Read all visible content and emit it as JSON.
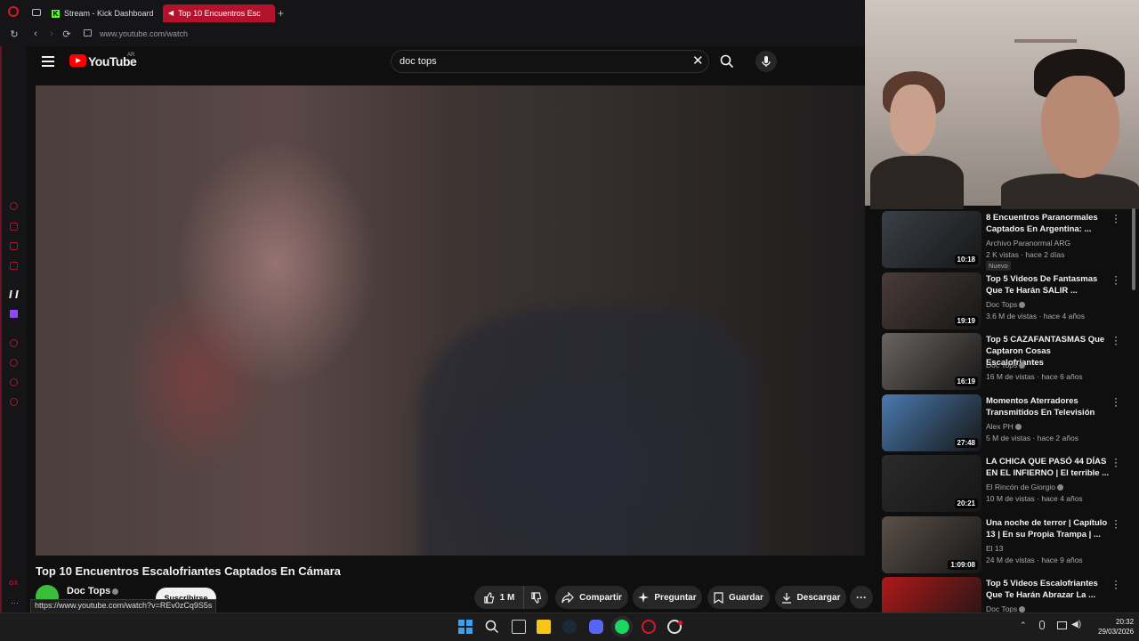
{
  "browser": {
    "tabs": [
      {
        "label": "Stream - Kick Dashboard",
        "active": false
      },
      {
        "label": "Top 10 Encuentros Esc",
        "active": true
      }
    ],
    "url": "www.youtube.com/watch",
    "status_url": "https://www.youtube.com/watch?v=REv0zCq9S5s"
  },
  "youtube": {
    "logo_text": "YouTube",
    "country_code": "AR",
    "search": {
      "value": "doc tops"
    },
    "video": {
      "title": "Top 10 Encuentros Escalofriantes Captados En Cámara",
      "channel": "Doc Tops",
      "subscribe_label": "Suscribirse",
      "like_count": "1 M",
      "share_label": "Compartir",
      "ask_label": "Preguntar",
      "save_label": "Guardar",
      "download_label": "Descargar"
    },
    "recommendations": [
      {
        "title": "8 Encuentros Paranormales Captados En Argentina: ...",
        "channel": "Archivo Paranormal ARG",
        "meta": "2 K vistas · hace 2 días",
        "duration": "10:18",
        "badge": "Nuevo",
        "verified": false,
        "thumb": "#3a4048"
      },
      {
        "title": "Top 5 Videos De Fantasmas Que Te Harán SALIR ...",
        "channel": "Doc Tops",
        "meta": "3.6 M de vistas · hace 4 años",
        "duration": "19:19",
        "badge": "",
        "verified": true,
        "thumb": "#4a3c38"
      },
      {
        "title": "Top 5 CAZAFANTASMAS Que Captaron Cosas Escalofriantes",
        "channel": "Doc Tops",
        "meta": "16 M de vistas · hace 6 años",
        "duration": "16:19",
        "badge": "",
        "verified": true,
        "thumb": "#6a6460"
      },
      {
        "title": "Momentos Aterradores Transmitidos En Televisión",
        "channel": "Alex PH",
        "meta": "5 M de vistas · hace 2 años",
        "duration": "27:48",
        "badge": "",
        "verified": true,
        "thumb": "#4a7ab0"
      },
      {
        "title": "LA CHICA QUE PASÓ 44 DÍAS EN EL INFIERNO | El terrible ...",
        "channel": "El Rincón de Giorgio",
        "meta": "10 M de vistas · hace 4 años",
        "duration": "20:21",
        "badge": "",
        "verified": true,
        "thumb": "#2a2a2a"
      },
      {
        "title": "Una noche de terror | Capítulo 13 | En su Propia Trampa | ...",
        "channel": "El 13",
        "meta": "24 M de vistas · hace 9 años",
        "duration": "1:09:08",
        "badge": "",
        "verified": false,
        "thumb": "#5a5048"
      },
      {
        "title": "Top 5 Videos Escalofriantes Que Te Harán Abrazar La ...",
        "channel": "Doc Tops",
        "meta": "",
        "duration": "",
        "badge": "",
        "verified": true,
        "thumb": "#b01818"
      }
    ]
  },
  "taskbar": {
    "time": "20:32",
    "date": "29/03/2026"
  },
  "colors": {
    "youtube_red": "#ff0000",
    "opera_red": "#d8182a",
    "spotify_green": "#1ed760",
    "kick_green": "#53fc18"
  }
}
